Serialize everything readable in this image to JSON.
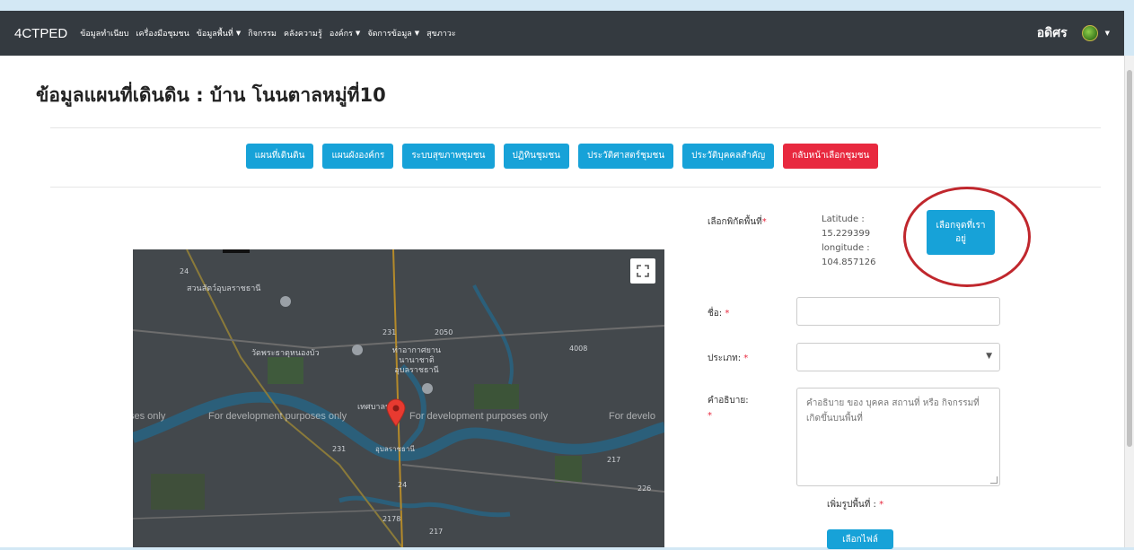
{
  "navbar": {
    "brand": "4CTPED",
    "links": [
      {
        "label": "ข้อมูลทำเนียบ"
      },
      {
        "label": "เครื่องมือชุมชน"
      },
      {
        "label": "ข้อมูลพื้นที่"
      },
      {
        "label": "กิจกรรม"
      },
      {
        "label": "คลังความรู้"
      },
      {
        "label": "องค์กร"
      },
      {
        "label": "จัดการข้อมูล"
      },
      {
        "label": "สุขภาวะ"
      }
    ],
    "user": "อดิศร"
  },
  "page": {
    "title": "ข้อมูลแผนที่เดินดิน : บ้าน โนนตาลหมู่ที่10"
  },
  "tabs": [
    {
      "label": "แผนที่เดินดิน"
    },
    {
      "label": "แผนผังองค์กร"
    },
    {
      "label": "ระบบสุขภาพชุมชน"
    },
    {
      "label": "ปฏิทินชุมชน"
    },
    {
      "label": "ประวัติศาสตร์ชุมชน"
    },
    {
      "label": "ประวัติบุคคลสำคัญ"
    },
    {
      "label": "กลับหน้าเลือกชุมชน"
    }
  ],
  "map": {
    "dev_text": "For development purposes only",
    "dev_text_left": "ses only",
    "dev_text_right": "For develo",
    "labels": {
      "zoo": "สวนสัตว์อุบลราชธานี",
      "temple": "วัดพระธาตุหนองบัว",
      "airport": "ท่าอากาศยาน นานาชาติ อุบลราชธานี",
      "municipality": "เทศบาลนคร",
      "city": "อุบลราชธานี"
    },
    "roads": [
      "24",
      "231",
      "2050",
      "4008",
      "231",
      "217",
      "24",
      "2178",
      "217",
      "226"
    ]
  },
  "form": {
    "location_label": "เลือกพิกัดพื้นที่",
    "latitude_label": "Latitude :",
    "latitude": "15.229399",
    "longitude_label": "longitude :",
    "longitude": "104.857126",
    "locate_button": "เลือกจุดที่เราอยู่",
    "name_label": "ชื่อ:",
    "name_value": "",
    "type_label": "ประเภท:",
    "type_value": "",
    "desc_label": "คำอธิบาย:",
    "desc_placeholder": "คำอธิบาย ของ บุคคล สถานที่ หรือ กิจกรรมที่เกิดขึ้นบนพื้นที่",
    "photo_label": "เพิ่มรูปพื้นที่ :",
    "file_button": "เลือกไฟล์",
    "required_mark": "*"
  },
  "colors": {
    "navbar_bg": "#343a40",
    "primary": "#17a2d8",
    "danger": "#e8293f",
    "highlight_circle": "#c0272d"
  }
}
